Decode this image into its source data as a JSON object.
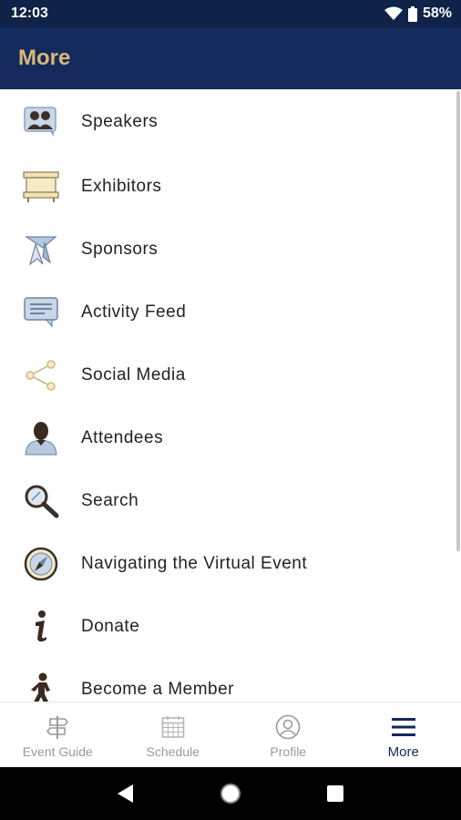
{
  "status_bar": {
    "time": "12:03",
    "battery": "58%",
    "icons": [
      "wifi-icon",
      "battery-icon"
    ]
  },
  "app_bar": {
    "title": "More"
  },
  "menu": {
    "items": [
      {
        "label": "Speakers",
        "icon": "speakers-icon"
      },
      {
        "label": "Exhibitors",
        "icon": "exhibitors-booth-icon"
      },
      {
        "label": "Sponsors",
        "icon": "sponsors-ribbon-icon"
      },
      {
        "label": "Activity Feed",
        "icon": "chat-bubble-icon"
      },
      {
        "label": "Social Media",
        "icon": "share-icon"
      },
      {
        "label": "Attendees",
        "icon": "person-icon"
      },
      {
        "label": "Search",
        "icon": "magnifier-icon"
      },
      {
        "label": "Navigating the Virtual Event",
        "icon": "compass-icon"
      },
      {
        "label": "Donate",
        "icon": "info-icon"
      },
      {
        "label": "Become a Member",
        "icon": "walking-person-icon"
      }
    ]
  },
  "bottom_nav": {
    "items": [
      {
        "label": "Event Guide",
        "icon": "signpost-icon",
        "active": false
      },
      {
        "label": "Schedule",
        "icon": "calendar-icon",
        "active": false
      },
      {
        "label": "Profile",
        "icon": "profile-icon",
        "active": false
      },
      {
        "label": "More",
        "icon": "hamburger-menu-icon",
        "active": true
      }
    ]
  },
  "system_nav": {
    "buttons": [
      "back-icon",
      "home-icon",
      "recents-icon"
    ]
  },
  "colors": {
    "status_bar": "#0f2247",
    "app_bar": "#142a5c",
    "title_gold": "#d9b877",
    "active_nav": "#142a5c",
    "inactive_nav": "#9a9a9a"
  }
}
